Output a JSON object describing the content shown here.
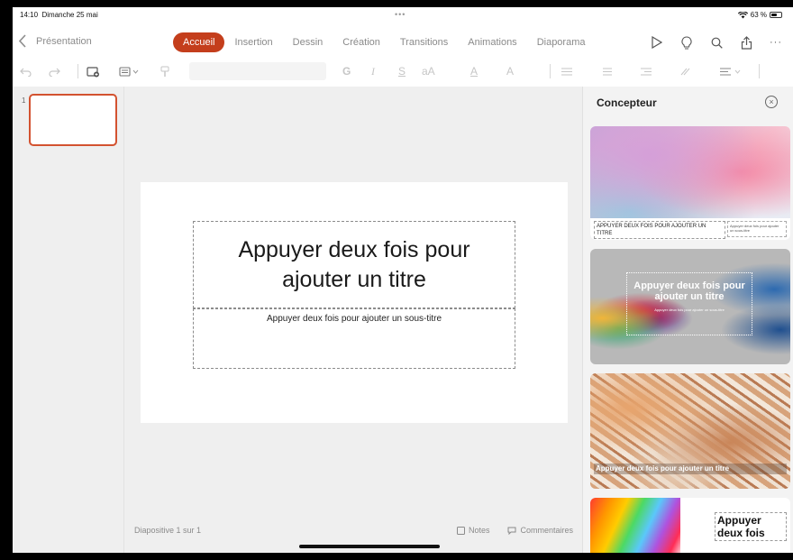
{
  "status": {
    "time": "14:10",
    "date": "Dimanche 25 mai",
    "dots": "•••",
    "battery": "63 %",
    "battery_level": 0.63
  },
  "nav": {
    "back_label": "Présentation"
  },
  "tabs": [
    "Accueil",
    "Insertion",
    "Dessin",
    "Création",
    "Transitions",
    "Animations",
    "Diaporama"
  ],
  "active_tab": "Accueil",
  "tab_icons": [
    "play-icon",
    "lightbulb-icon",
    "search-icon",
    "share-icon",
    "more-icon"
  ],
  "ribbon": {
    "bold": "G",
    "italic": "I",
    "strike": "S",
    "fontsize": "aA",
    "textcolor": "A",
    "highlight": "A"
  },
  "thumbnails": {
    "number": "1"
  },
  "slide": {
    "title_placeholder": "Appuyer deux fois pour ajouter un titre",
    "subtitle_placeholder": "Appuyer deux fois pour ajouter un sous-titre"
  },
  "footer": {
    "slide_count": "Diapositive 1 sur 1",
    "notes": "Notes",
    "comments": "Commentaires"
  },
  "designer": {
    "title": "Concepteur",
    "close": "×",
    "cards": [
      {
        "caption": "APPUYER DEUX FOIS POUR AJOUTER UN TITRE",
        "sub": "Appuyer deux fois pour ajouter un sous-titre"
      },
      {
        "caption": "Appuyer deux fois pour ajouter un titre",
        "sub": "Appuyer deux fois pour ajouter un sous-titre"
      },
      {
        "caption": "Appuyer deux fois pour ajouter un titre"
      },
      {
        "caption": "Appuyer deux fois"
      }
    ]
  },
  "colors": {
    "accent": "#c43e1c",
    "thumb_border": "#d35230"
  }
}
